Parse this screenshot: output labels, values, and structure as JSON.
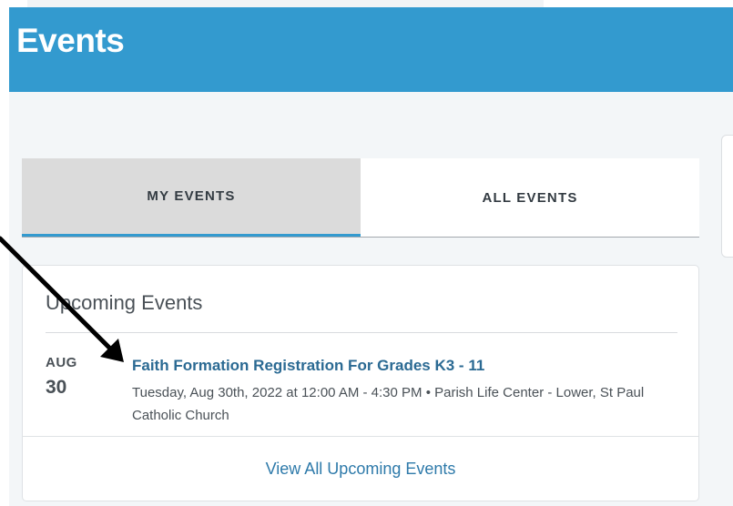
{
  "header": {
    "title": "Events"
  },
  "tabs": [
    {
      "label": "MY EVENTS",
      "active": true
    },
    {
      "label": "ALL EVENTS",
      "active": false
    }
  ],
  "upcoming": {
    "heading": "Upcoming Events",
    "events": [
      {
        "month": "AUG",
        "day": "30",
        "title": "Faith Formation Registration For Grades K3 - 11",
        "details": "Tuesday, Aug 30th, 2022 at 12:00 AM - 4:30 PM • Parish Life Center - Lower, St Paul Catholic Church"
      }
    ],
    "view_all_label": "View All Upcoming Events"
  },
  "colors": {
    "header_blue": "#339acf",
    "link_blue": "#2b6a93",
    "active_tab_bg": "#dbdbdb"
  }
}
